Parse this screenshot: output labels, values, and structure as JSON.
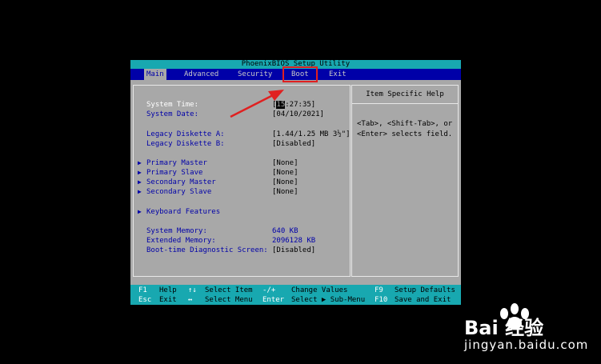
{
  "title": "PhoenixBIOS Setup Utility",
  "menu": [
    "Main",
    "Advanced",
    "Security",
    "Boot",
    "Exit"
  ],
  "settings": {
    "time_label": "System Time:",
    "time_cursor": "15",
    "time_rest": ":27:35]",
    "date_label": "System Date:",
    "date_value": "[04/10/2021]",
    "disk_a_label": "Legacy Diskette A:",
    "disk_a_value": "[1.44/1.25 MB  3½\"]",
    "disk_b_label": "Legacy Diskette B:",
    "disk_b_value": "[Disabled]",
    "pm_label": "Primary Master",
    "pm_value": "[None]",
    "ps_label": "Primary Slave",
    "ps_value": "[None]",
    "sm_label": "Secondary Master",
    "sm_value": "[None]",
    "ss_label": "Secondary Slave",
    "ss_value": "[None]",
    "kb_label": "Keyboard Features",
    "sysmem_label": "System Memory:",
    "sysmem_value": "640 KB",
    "extmem_label": "Extended Memory:",
    "extmem_value": "2096128 KB",
    "diag_label": "Boot-time Diagnostic Screen:",
    "diag_value": "[Disabled]"
  },
  "help": {
    "title": "Item Specific Help",
    "text": "<Tab>, <Shift-Tab>, or <Enter> selects field."
  },
  "footer": {
    "f1": "F1",
    "help": "Help",
    "updown": "↑↓",
    "select_item": "Select Item",
    "minus_plus": "-/+",
    "change_values": "Change Values",
    "f9": "F9",
    "setup_defaults": "Setup Defaults",
    "esc": "Esc",
    "exit": "Exit",
    "leftright": "↔",
    "select_menu": "Select Menu",
    "enter": "Enter",
    "select_submenu": "Select ▶ Sub-Menu",
    "f10": "F10",
    "save_exit": "Save and Exit"
  },
  "watermark": {
    "brand": "Bai  经验",
    "url": "jingyan.baidu.com"
  },
  "colors": {
    "bios_gray": "#a8a8a8",
    "bios_blue": "#0000a8",
    "bios_cyan": "#18a8b0",
    "annotation_red": "#e02020"
  }
}
